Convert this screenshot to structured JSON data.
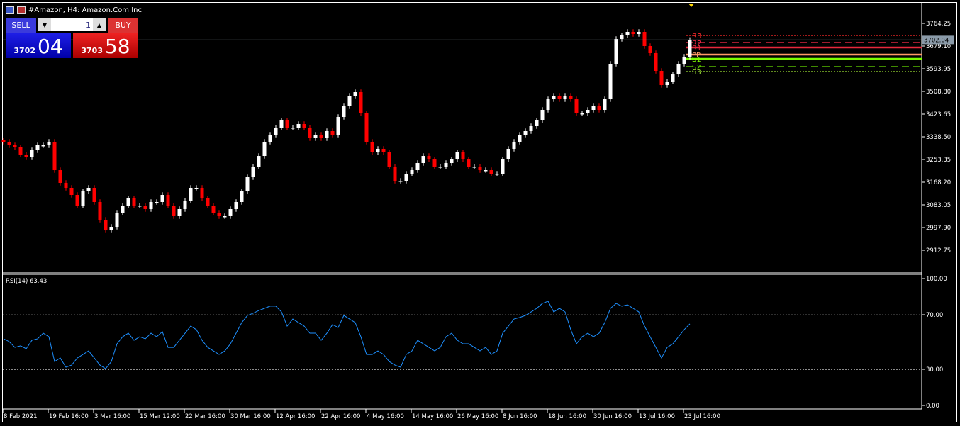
{
  "window": {
    "title": "#Amazon, H4:  Amazon.Com Inc"
  },
  "trade_panel": {
    "sell_label": "SELL",
    "buy_label": "BUY",
    "volume": "1",
    "bid_prefix": "3702",
    "bid_big": "04",
    "ask_prefix": "3703",
    "ask_big": "58"
  },
  "colors": {
    "bull": "#ffffff",
    "bear": "#ff0000",
    "rsi": "#1e90ff",
    "price_line": "#8a9aa8",
    "bg": "#000000"
  },
  "chart_data": [
    {
      "type": "candlestick",
      "symbol": "#Amazon",
      "timeframe": "H4",
      "current_price": "3702.04",
      "y_ticks": [
        "3764.25",
        "3679.10",
        "3593.95",
        "3508.80",
        "3423.65",
        "3338.50",
        "3253.35",
        "3168.20",
        "3083.05",
        "2997.90",
        "2912.75"
      ],
      "ylim": [
        2912.75,
        3764.25
      ],
      "x_ticks": [
        {
          "label": "8 Feb 2021",
          "index": 0
        },
        {
          "label": "19 Feb 16:00",
          "index": 8
        },
        {
          "label": "3 Mar 16:00",
          "index": 16
        },
        {
          "label": "15 Mar 12:00",
          "index": 24
        },
        {
          "label": "22 Mar 16:00",
          "index": 32
        },
        {
          "label": "30 Mar 16:00",
          "index": 40
        },
        {
          "label": "12 Apr 16:00",
          "index": 48
        },
        {
          "label": "22 Apr 16:00",
          "index": 56
        },
        {
          "label": "4 May 16:00",
          "index": 64
        },
        {
          "label": "14 May 16:00",
          "index": 72
        },
        {
          "label": "26 May 16:00",
          "index": 80
        },
        {
          "label": "8 Jun 16:00",
          "index": 88
        },
        {
          "label": "18 Jun 16:00",
          "index": 96
        },
        {
          "label": "30 Jun 16:00",
          "index": 104
        },
        {
          "label": "13 Jul 16:00",
          "index": 112
        },
        {
          "label": "23 Jul 16:00",
          "index": 120
        }
      ],
      "closes": [
        3319.9,
        3306.6,
        3298.6,
        3272.0,
        3261.3,
        3288.0,
        3306.6,
        3306.6,
        3319.9,
        3213.4,
        3165.5,
        3146.9,
        3120.3,
        3080.4,
        3133.6,
        3146.9,
        3093.7,
        3027.1,
        2987.2,
        3000.5,
        3053.8,
        3080.4,
        3107.0,
        3080.4,
        3080.4,
        3067.1,
        3093.7,
        3093.7,
        3120.3,
        3080.4,
        3040.5,
        3067.1,
        3099.0,
        3146.9,
        3146.9,
        3107.0,
        3080.4,
        3053.8,
        3040.5,
        3040.5,
        3067.1,
        3093.7,
        3133.6,
        3186.8,
        3226.7,
        3266.6,
        3319.9,
        3346.5,
        3373.1,
        3399.7,
        3373.1,
        3373.1,
        3386.4,
        3373.1,
        3333.2,
        3346.5,
        3333.2,
        3359.8,
        3346.5,
        3413.0,
        3452.9,
        3492.8,
        3506.1,
        3426.3,
        3319.9,
        3280.0,
        3293.3,
        3280.0,
        3226.7,
        3173.5,
        3173.5,
        3200.1,
        3213.4,
        3240.0,
        3266.6,
        3253.3,
        3226.7,
        3226.7,
        3240.0,
        3253.3,
        3280.0,
        3253.3,
        3226.7,
        3226.7,
        3213.4,
        3213.4,
        3200.1,
        3200.1,
        3253.3,
        3293.3,
        3319.9,
        3346.5,
        3359.8,
        3378.4,
        3399.7,
        3439.6,
        3479.5,
        3492.8,
        3479.5,
        3492.8,
        3479.5,
        3426.3,
        3426.3,
        3439.6,
        3452.9,
        3439.6,
        3479.5,
        3612.6,
        3705.7,
        3719.0,
        3732.3,
        3724.3,
        3732.3,
        3679.1,
        3652.5,
        3586.0,
        3532.7,
        3546.0,
        3572.6,
        3612.6,
        3639.2,
        3702.04
      ],
      "pivots": [
        {
          "label": "R3",
          "value": 3719.0,
          "color": "#ff2a2a",
          "style": "dotted"
        },
        {
          "label": "R2",
          "value": 3692.4,
          "color": "#ff2a4a",
          "style": "dashed"
        },
        {
          "label": "R1",
          "value": 3673.8,
          "color": "#e8283c",
          "style": "solid"
        },
        {
          "label": "PP",
          "value": 3647.2,
          "color": "#ff9a66",
          "style": "solid"
        },
        {
          "label": "S1",
          "value": 3631.2,
          "color": "#7cfc00",
          "style": "solid"
        },
        {
          "label": "S2",
          "value": 3601.9,
          "color": "#66dd00",
          "style": "dashed"
        },
        {
          "label": "S3",
          "value": 3583.3,
          "color": "#99dd33",
          "style": "dotted"
        }
      ]
    },
    {
      "type": "line",
      "indicator_label": "RSI(14) 63.43",
      "y_ticks": [
        "100.00",
        "70.00",
        "30.00",
        "0.00"
      ],
      "levels": [
        70,
        30
      ],
      "ylim": [
        0,
        100
      ],
      "values": [
        52.5,
        50.4,
        46.2,
        47.3,
        45.2,
        51.4,
        52.5,
        56.6,
        54.0,
        35.8,
        38.4,
        31.7,
        33.2,
        38.4,
        41.0,
        43.6,
        38.4,
        33.2,
        30.6,
        35.8,
        48.8,
        54.0,
        56.6,
        51.4,
        54.0,
        52.5,
        56.6,
        54.0,
        57.7,
        46.2,
        46.2,
        51.4,
        56.6,
        61.8,
        59.2,
        51.4,
        46.2,
        43.6,
        41.0,
        43.6,
        48.8,
        56.6,
        64.4,
        69.6,
        71.2,
        73.2,
        74.8,
        76.4,
        76.4,
        72.2,
        61.8,
        67.0,
        64.4,
        61.8,
        56.6,
        56.6,
        51.4,
        56.6,
        62.9,
        60.8,
        69.6,
        67.0,
        64.4,
        54.0,
        41.0,
        41.0,
        43.6,
        41.0,
        35.8,
        33.2,
        31.7,
        41.0,
        43.6,
        51.4,
        48.8,
        46.2,
        43.6,
        46.2,
        54.0,
        56.6,
        51.4,
        48.8,
        48.8,
        46.2,
        43.6,
        46.2,
        41.0,
        43.6,
        56.6,
        61.8,
        67.0,
        68.1,
        69.6,
        72.2,
        74.8,
        78.4,
        80.0,
        72.2,
        74.8,
        72.2,
        59.2,
        48.8,
        54.0,
        56.6,
        54.0,
        56.6,
        64.4,
        74.8,
        78.4,
        76.4,
        77.4,
        74.8,
        72.2,
        61.8,
        54.0,
        46.2,
        38.4,
        46.2,
        48.8,
        54.0,
        59.2,
        63.43
      ]
    }
  ]
}
